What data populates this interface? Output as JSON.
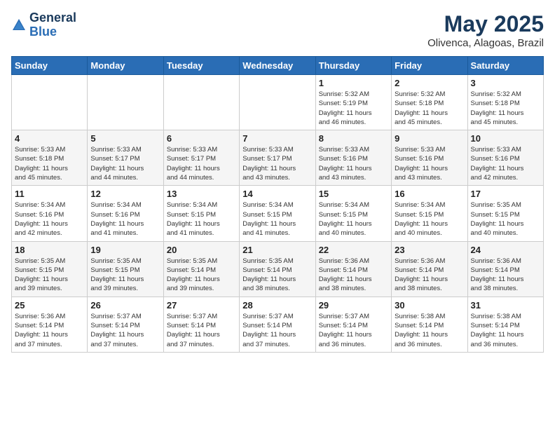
{
  "header": {
    "logo_general": "General",
    "logo_blue": "Blue",
    "month_year": "May 2025",
    "location": "Olivenca, Alagoas, Brazil"
  },
  "weekdays": [
    "Sunday",
    "Monday",
    "Tuesday",
    "Wednesday",
    "Thursday",
    "Friday",
    "Saturday"
  ],
  "weeks": [
    [
      {
        "day": "",
        "info": ""
      },
      {
        "day": "",
        "info": ""
      },
      {
        "day": "",
        "info": ""
      },
      {
        "day": "",
        "info": ""
      },
      {
        "day": "1",
        "info": "Sunrise: 5:32 AM\nSunset: 5:19 PM\nDaylight: 11 hours\nand 46 minutes."
      },
      {
        "day": "2",
        "info": "Sunrise: 5:32 AM\nSunset: 5:18 PM\nDaylight: 11 hours\nand 45 minutes."
      },
      {
        "day": "3",
        "info": "Sunrise: 5:32 AM\nSunset: 5:18 PM\nDaylight: 11 hours\nand 45 minutes."
      }
    ],
    [
      {
        "day": "4",
        "info": "Sunrise: 5:33 AM\nSunset: 5:18 PM\nDaylight: 11 hours\nand 45 minutes."
      },
      {
        "day": "5",
        "info": "Sunrise: 5:33 AM\nSunset: 5:17 PM\nDaylight: 11 hours\nand 44 minutes."
      },
      {
        "day": "6",
        "info": "Sunrise: 5:33 AM\nSunset: 5:17 PM\nDaylight: 11 hours\nand 44 minutes."
      },
      {
        "day": "7",
        "info": "Sunrise: 5:33 AM\nSunset: 5:17 PM\nDaylight: 11 hours\nand 43 minutes."
      },
      {
        "day": "8",
        "info": "Sunrise: 5:33 AM\nSunset: 5:16 PM\nDaylight: 11 hours\nand 43 minutes."
      },
      {
        "day": "9",
        "info": "Sunrise: 5:33 AM\nSunset: 5:16 PM\nDaylight: 11 hours\nand 43 minutes."
      },
      {
        "day": "10",
        "info": "Sunrise: 5:33 AM\nSunset: 5:16 PM\nDaylight: 11 hours\nand 42 minutes."
      }
    ],
    [
      {
        "day": "11",
        "info": "Sunrise: 5:34 AM\nSunset: 5:16 PM\nDaylight: 11 hours\nand 42 minutes."
      },
      {
        "day": "12",
        "info": "Sunrise: 5:34 AM\nSunset: 5:16 PM\nDaylight: 11 hours\nand 41 minutes."
      },
      {
        "day": "13",
        "info": "Sunrise: 5:34 AM\nSunset: 5:15 PM\nDaylight: 11 hours\nand 41 minutes."
      },
      {
        "day": "14",
        "info": "Sunrise: 5:34 AM\nSunset: 5:15 PM\nDaylight: 11 hours\nand 41 minutes."
      },
      {
        "day": "15",
        "info": "Sunrise: 5:34 AM\nSunset: 5:15 PM\nDaylight: 11 hours\nand 40 minutes."
      },
      {
        "day": "16",
        "info": "Sunrise: 5:34 AM\nSunset: 5:15 PM\nDaylight: 11 hours\nand 40 minutes."
      },
      {
        "day": "17",
        "info": "Sunrise: 5:35 AM\nSunset: 5:15 PM\nDaylight: 11 hours\nand 40 minutes."
      }
    ],
    [
      {
        "day": "18",
        "info": "Sunrise: 5:35 AM\nSunset: 5:15 PM\nDaylight: 11 hours\nand 39 minutes."
      },
      {
        "day": "19",
        "info": "Sunrise: 5:35 AM\nSunset: 5:15 PM\nDaylight: 11 hours\nand 39 minutes."
      },
      {
        "day": "20",
        "info": "Sunrise: 5:35 AM\nSunset: 5:14 PM\nDaylight: 11 hours\nand 39 minutes."
      },
      {
        "day": "21",
        "info": "Sunrise: 5:35 AM\nSunset: 5:14 PM\nDaylight: 11 hours\nand 38 minutes."
      },
      {
        "day": "22",
        "info": "Sunrise: 5:36 AM\nSunset: 5:14 PM\nDaylight: 11 hours\nand 38 minutes."
      },
      {
        "day": "23",
        "info": "Sunrise: 5:36 AM\nSunset: 5:14 PM\nDaylight: 11 hours\nand 38 minutes."
      },
      {
        "day": "24",
        "info": "Sunrise: 5:36 AM\nSunset: 5:14 PM\nDaylight: 11 hours\nand 38 minutes."
      }
    ],
    [
      {
        "day": "25",
        "info": "Sunrise: 5:36 AM\nSunset: 5:14 PM\nDaylight: 11 hours\nand 37 minutes."
      },
      {
        "day": "26",
        "info": "Sunrise: 5:37 AM\nSunset: 5:14 PM\nDaylight: 11 hours\nand 37 minutes."
      },
      {
        "day": "27",
        "info": "Sunrise: 5:37 AM\nSunset: 5:14 PM\nDaylight: 11 hours\nand 37 minutes."
      },
      {
        "day": "28",
        "info": "Sunrise: 5:37 AM\nSunset: 5:14 PM\nDaylight: 11 hours\nand 37 minutes."
      },
      {
        "day": "29",
        "info": "Sunrise: 5:37 AM\nSunset: 5:14 PM\nDaylight: 11 hours\nand 36 minutes."
      },
      {
        "day": "30",
        "info": "Sunrise: 5:38 AM\nSunset: 5:14 PM\nDaylight: 11 hours\nand 36 minutes."
      },
      {
        "day": "31",
        "info": "Sunrise: 5:38 AM\nSunset: 5:14 PM\nDaylight: 11 hours\nand 36 minutes."
      }
    ]
  ]
}
